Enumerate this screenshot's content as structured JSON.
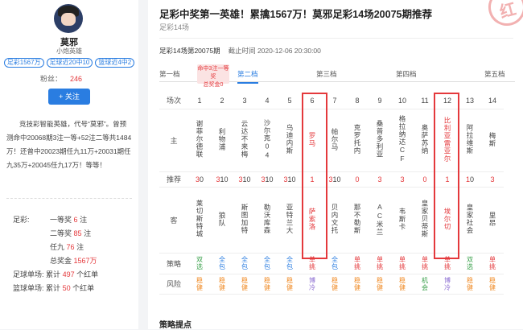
{
  "sidebar": {
    "name": "莫邪",
    "title": "小炮英雄",
    "tags": [
      "足彩1567万",
      "足球近20中10",
      "篮球近4中2"
    ],
    "fans_label": "粉丝：",
    "fans": "246",
    "follow": "+ 关注",
    "intro": "竞技彩智能英雄，代号“莫邪”。曾预测命中20068期3注一等+52注二等共1484万！还曾中20023期任九11万+20031期任九35万+20045任九17万！等等！",
    "stats": {
      "zucai_label": "足彩:",
      "first_label": "一等奖",
      "first": "6",
      "second_label": "二等奖",
      "second": "85",
      "r9_label": "任九",
      "r9": "76",
      "unit": "注",
      "total_label": "总奖金",
      "total": "1567万",
      "fb_label": "足球单场:",
      "fb_pre": "累计",
      "fb": "497",
      "fb_post": "个红单",
      "bb_label": "篮球单场:",
      "bb_pre": "累计",
      "bb": "50",
      "bb_post": "个红单"
    }
  },
  "main": {
    "title": "足彩中奖第一英雄！累擒1567万！莫邪足彩14场20075期推荐",
    "subtitle": "足彩14场",
    "issue": "足彩14场第20075期",
    "deadline": "截止时间 2020-12-06 20:30:00",
    "stamp": "红",
    "tabs": [
      "第一档",
      "第二档",
      "第三档",
      "第四档",
      "第五档"
    ],
    "bubble": "命中3注一等奖\n总奖金0",
    "row_labels": {
      "num": "场次",
      "home": "主",
      "rec": "推荐",
      "away": "客",
      "strategy": "策略",
      "risk": "风险"
    },
    "matches": [
      {
        "n": "1",
        "home": "谢菲尔德联",
        "rec": [
          "3",
          "0",
          ""
        ],
        "away": "莱切斯特城",
        "strat": "双选",
        "risk": "稳健"
      },
      {
        "n": "2",
        "home": "利物浦",
        "rec": [
          "3",
          "1",
          "0"
        ],
        "away": "狼队",
        "strat": "全包",
        "risk": "稳健"
      },
      {
        "n": "3",
        "home": "云达不来梅",
        "rec": [
          "3",
          "1",
          "0"
        ],
        "away": "斯图加特",
        "strat": "全包",
        "risk": "稳健"
      },
      {
        "n": "4",
        "home": "沙尔克04",
        "rec": [
          "3",
          "1",
          "0"
        ],
        "away": "勒沃库森",
        "strat": "全包",
        "risk": "稳健"
      },
      {
        "n": "5",
        "home": "乌迪内斯",
        "rec": [
          "3",
          "1",
          "0"
        ],
        "away": "亚特兰大",
        "strat": "全包",
        "risk": "稳健"
      },
      {
        "n": "6",
        "home": "罗马",
        "rec": [
          "1",
          "",
          ""
        ],
        "away": "萨索洛",
        "strat": "单挑",
        "risk": "博冷"
      },
      {
        "n": "7",
        "home": "帕尔马",
        "rec": [
          "3",
          "1",
          "0"
        ],
        "away": "贝内文托",
        "strat": "全包",
        "risk": "稳健"
      },
      {
        "n": "8",
        "home": "克罗托内",
        "rec": [
          "0",
          "",
          ""
        ],
        "away": "那不勒斯",
        "strat": "单挑",
        "risk": "稳健"
      },
      {
        "n": "9",
        "home": "桑普多利亚",
        "rec": [
          "3",
          "",
          ""
        ],
        "away": "AC米兰",
        "strat": "单挑",
        "risk": "稳健"
      },
      {
        "n": "10",
        "home": "格拉纳达CF",
        "rec": [
          "3",
          "",
          ""
        ],
        "away": "韦斯卡",
        "strat": "单挑",
        "risk": "稳健"
      },
      {
        "n": "11",
        "home": "奥萨苏纳",
        "rec": [
          "0",
          "",
          ""
        ],
        "away": "皇家贝蒂斯",
        "strat": "单挑",
        "risk": "机会"
      },
      {
        "n": "12",
        "home": "比利亚雷亚尔",
        "rec": [
          "1",
          "",
          ""
        ],
        "away": "埃尔切",
        "strat": "单挑",
        "risk": "博冷"
      },
      {
        "n": "13",
        "home": "阿拉维斯",
        "rec": [
          "1",
          "0",
          ""
        ],
        "away": "皇家社会",
        "strat": "双选",
        "risk": "稳健"
      },
      {
        "n": "14",
        "home": "梅斯",
        "rec": [
          "3",
          "",
          ""
        ],
        "away": "里昂",
        "strat": "单挑",
        "risk": "稳健"
      }
    ],
    "tips": "策略提点"
  },
  "colors": {
    "accent": "#2a7de1",
    "red": "#e4393c",
    "green": "#3aa04b",
    "orange": "#f08c28",
    "purple": "#8a6bd1"
  }
}
